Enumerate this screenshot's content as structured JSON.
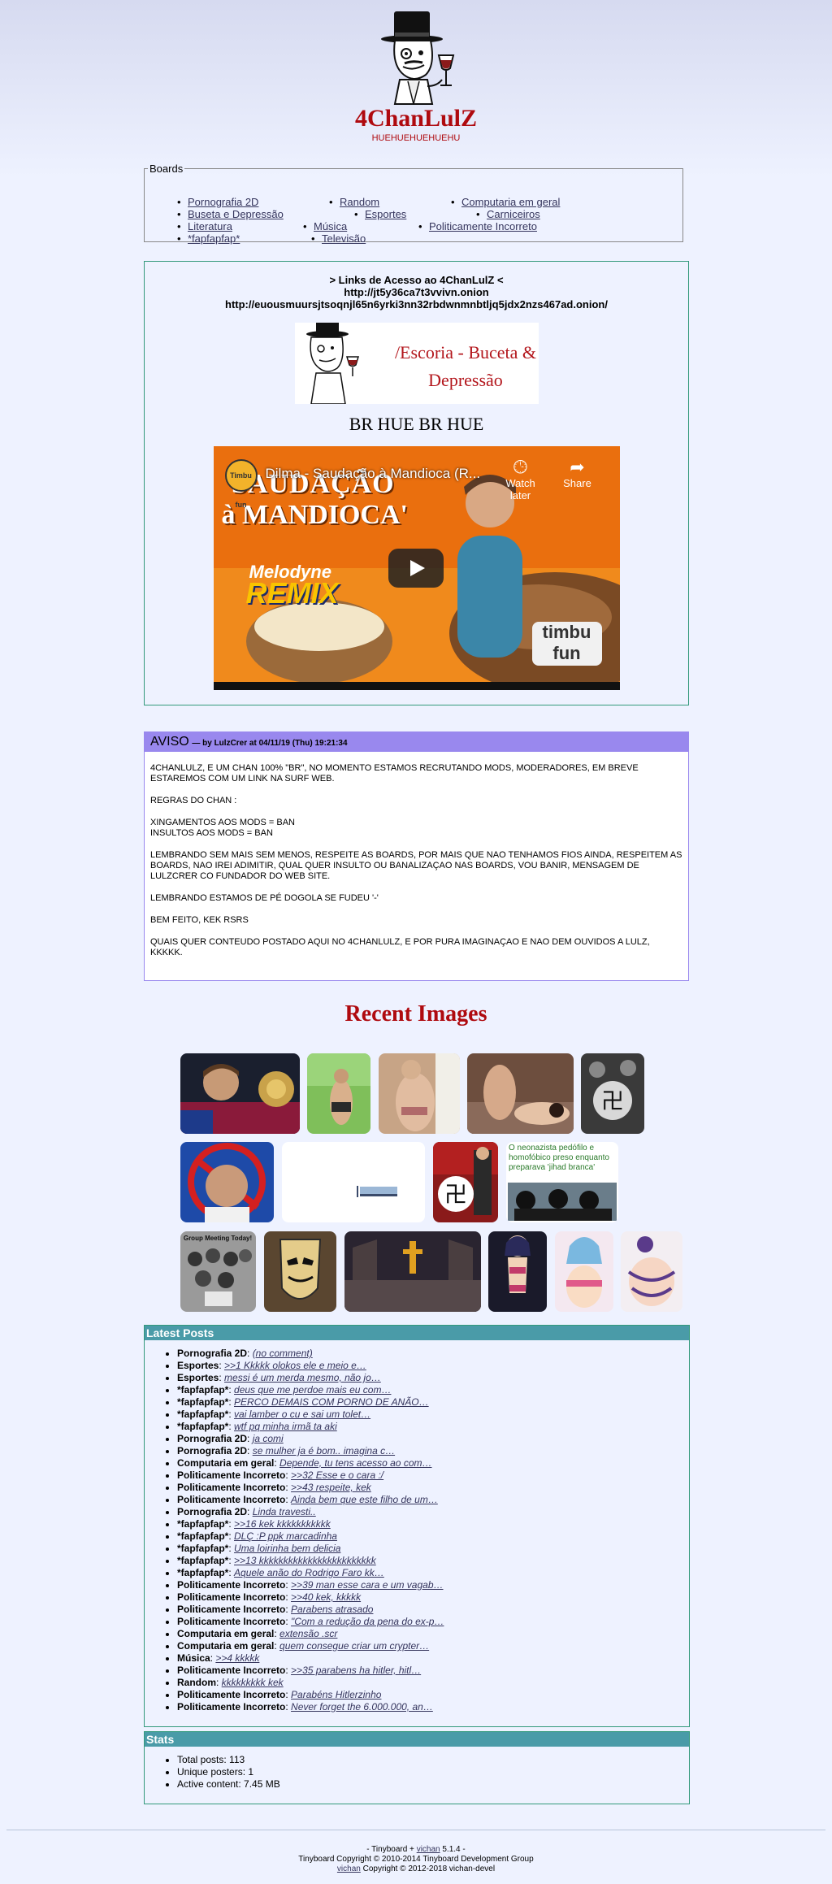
{
  "header": {
    "title": "4ChanLulZ",
    "subtitle": "HUEHUEHUEHUEHU"
  },
  "boards": {
    "legend": "Boards",
    "items": [
      "Pornografia 2D",
      "Random",
      "Computaria em geral",
      "Buseta e Depressão",
      "Esportes",
      "Carniceiros",
      "Literatura",
      "Música",
      "Politicamente Incorreto",
      "*fapfapfap*",
      "Televisão"
    ]
  },
  "links_box": {
    "line1": "> Links de Acesso ao 4ChanLulZ <",
    "line2": "http://jt5y36ca7t3vvivn.onion",
    "line3": "http://euousmuursjtsoqnjl65n6yrki3nn32rbdwnmnbtljq5jdx2nzs467ad.onion/",
    "banner_text_1": "/Escoria - Buceta &",
    "banner_text_2": "Depressão",
    "tagline": "BR HUE BR HUE",
    "video": {
      "title": "Dilma - Saudação à Mandioca (R...",
      "watch_later": "Watch later",
      "share": "Share",
      "channel_logo": "Timbu fun",
      "overlay_line1": "'SAUDAÇÃO",
      "overlay_line2": "à MANDIOCA'",
      "overlay_melodyne": "Melodyne",
      "overlay_remix": "REMIX",
      "corner_logo": "timbu fun"
    }
  },
  "aviso": {
    "title": "AVISO",
    "meta": "— by LulzCrer at 04/11/19 (Thu) 19:21:34",
    "paragraphs": [
      "4CHANLULZ, E UM CHAN 100% \"BR\", NO MOMENTO ESTAMOS RECRUTANDO MODS, MODERADORES, EM BREVE ESTAREMOS COM UM LINK NA SURF WEB.",
      "REGRAS DO CHAN :",
      "XINGAMENTOS AOS MODS = BAN\nINSULTOS AOS MODS = BAN",
      "LEMBRANDO SEM MAIS SEM MENOS, RESPEITE AS BOARDS, POR MAIS QUE NAO TENHAMOS FIOS AINDA, RESPEITEM AS BOARDS, NAO IREI ADIMITIR, QUAL QUER INSULTO OU BANALIZAÇAO NAS BOARDS, VOU BANIR, MENSAGEM DE LULZCRER CO FUNDADOR DO WEB SITE.",
      "LEMBRANDO ESTAMOS DE PÉ DOGOLA SE FUDEU '-'",
      "BEM FEITO, KEK RSRS",
      "QUAIS QUER CONTEUDO POSTADO AQUI NO 4CHANLULZ, E POR PURA IMAGINAÇAO E NAO DEM OUVIDOS A LULZ, KKKKK."
    ]
  },
  "recent_images": {
    "title": "Recent Images",
    "neo_caption": "O neonazista pedófilo e homofóbico preso enquanto preparava 'jihad branca'",
    "group_caption": "Group Meeting Today!"
  },
  "latest_posts": {
    "title": "Latest Posts",
    "items": [
      {
        "board": "Pornografia 2D",
        "text": "(no comment)"
      },
      {
        "board": "Esportes",
        "text": ">>1 Kkkkk olokos ele e meio e…"
      },
      {
        "board": "Esportes",
        "text": "messi é um merda mesmo, não jo…"
      },
      {
        "board": "*fapfapfap*",
        "text": "deus que me perdoe mais eu com…"
      },
      {
        "board": "*fapfapfap*",
        "text": "PERCO DEMAIS COM PORNO DE ANÃO…"
      },
      {
        "board": "*fapfapfap*",
        "text": "vai lamber o cu e sai um tolet…"
      },
      {
        "board": "*fapfapfap*",
        "text": "wtf pq minha irmã ta aki"
      },
      {
        "board": "Pornografia 2D",
        "text": "ja comi"
      },
      {
        "board": "Pornografia 2D",
        "text": "se mulher ja é bom.. imagina c…"
      },
      {
        "board": "Computaria em geral",
        "text": "Depende, tu tens acesso ao com…"
      },
      {
        "board": "Politicamente Incorreto",
        "text": ">>32 Esse e o cara :/"
      },
      {
        "board": "Politicamente Incorreto",
        "text": ">>43 respeite, kek"
      },
      {
        "board": "Politicamente Incorreto",
        "text": "Ainda bem que este filho de um…"
      },
      {
        "board": "Pornografia 2D",
        "text": "Linda travesti.."
      },
      {
        "board": "*fapfapfap*",
        "text": ">>16 kek kkkkkkkkkkk"
      },
      {
        "board": "*fapfapfap*",
        "text": "DLÇ :P ppk marcadinha"
      },
      {
        "board": "*fapfapfap*",
        "text": "Uma loirinha bem delicia"
      },
      {
        "board": "*fapfapfap*",
        "text": ">>13 kkkkkkkkkkkkkkkkkkkkkkkk"
      },
      {
        "board": "*fapfapfap*",
        "text": "Aquele anão do Rodrigo Faro kk…"
      },
      {
        "board": "Politicamente Incorreto",
        "text": ">>39 man esse cara e um vagab…"
      },
      {
        "board": "Politicamente Incorreto",
        "text": ">>40 kek, kkkkk"
      },
      {
        "board": "Politicamente Incorreto",
        "text": "Parabens atrasado"
      },
      {
        "board": "Politicamente Incorreto",
        "text": "\"Com a redução da pena do ex-p…"
      },
      {
        "board": "Computaria em geral",
        "text": "extensão .scr"
      },
      {
        "board": "Computaria em geral",
        "text": "quem consegue criar um crypter…"
      },
      {
        "board": "Música",
        "text": ">>4 kkkkk"
      },
      {
        "board": "Politicamente Incorreto",
        "text": ">>35 parabens ha hitler, hitl…"
      },
      {
        "board": "Random",
        "text": "kkkkkkkkk kek"
      },
      {
        "board": "Politicamente Incorreto",
        "text": "Parabéns Hitlerzinho"
      },
      {
        "board": "Politicamente Incorreto",
        "text": "Never forget the 6.000.000, an…"
      }
    ]
  },
  "stats": {
    "title": "Stats",
    "items": [
      "Total posts: 113",
      "Unique posters: 1",
      "Active content: 7.45 MB"
    ]
  },
  "footer": {
    "line1_prefix": "- Tinyboard +",
    "line1_link": "vichan",
    "line1_suffix": "5.1.4 -",
    "line2": "Tinyboard Copyright © 2010-2014 Tinyboard Development Group",
    "line3_link": "vichan",
    "line3_suffix": "Copyright © 2012-2018 vichan-devel"
  },
  "colors": {
    "title_red": "#af0a0f",
    "link": "#34345c",
    "aviso_header": "#9988ee",
    "section_header": "#4a9ba8",
    "box_border": "#339a7c"
  }
}
